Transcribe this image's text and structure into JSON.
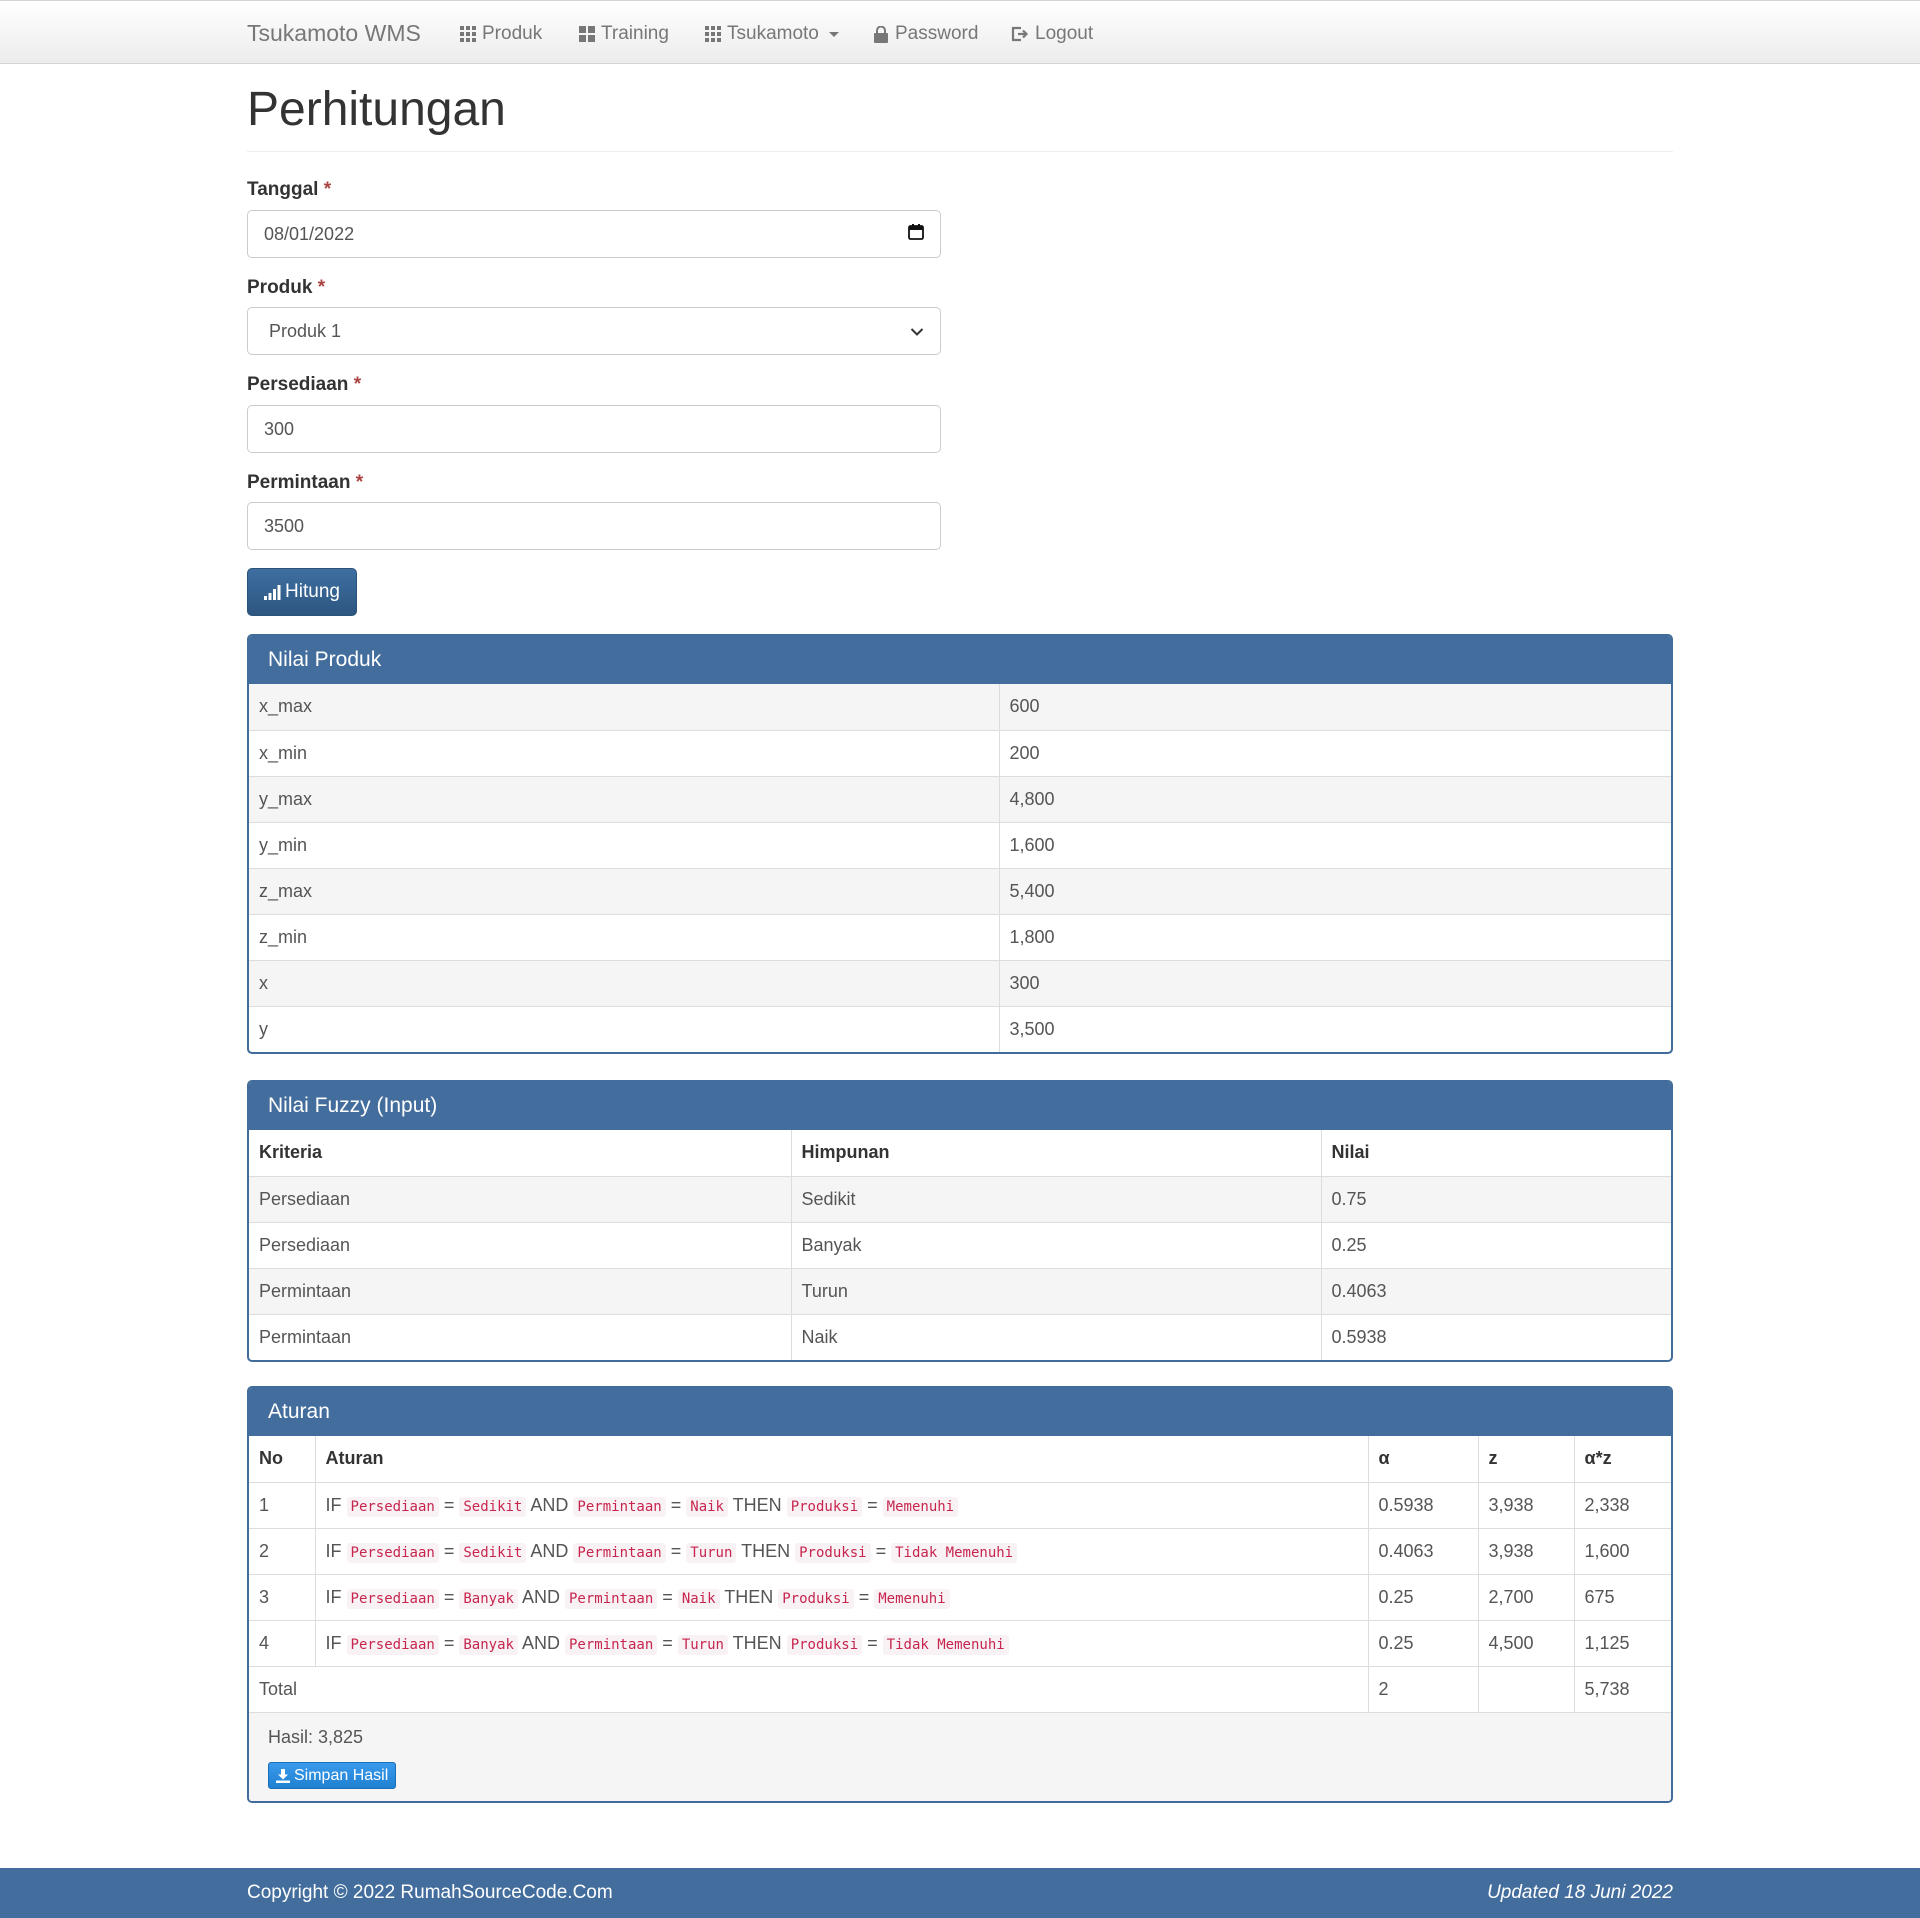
{
  "navbar": {
    "brand": "Tsukamoto WMS",
    "items": [
      {
        "label": "Produk",
        "icon": "grid-icon"
      },
      {
        "label": "Training",
        "icon": "th-large-icon"
      },
      {
        "label": "Tsukamoto",
        "icon": "grid-icon"
      },
      {
        "label": "Password",
        "icon": "lock-icon"
      },
      {
        "label": "Logout",
        "icon": "logout-icon"
      }
    ]
  },
  "page": {
    "title": "Perhitungan"
  },
  "form": {
    "required_mark": "*",
    "tanggal": {
      "label": "Tanggal",
      "value": "08/01/2022"
    },
    "produk": {
      "label": "Produk",
      "value": "Produk 1"
    },
    "persediaan": {
      "label": "Persediaan",
      "value": "300"
    },
    "permintaan": {
      "label": "Permintaan",
      "value": "3500"
    },
    "submit_label": "Hitung"
  },
  "nilai_produk": {
    "title": "Nilai Produk",
    "rows": [
      {
        "key": "x_max",
        "value": "600"
      },
      {
        "key": "x_min",
        "value": "200"
      },
      {
        "key": "y_max",
        "value": "4,800"
      },
      {
        "key": "y_min",
        "value": "1,600"
      },
      {
        "key": "z_max",
        "value": "5,400"
      },
      {
        "key": "z_min",
        "value": "1,800"
      },
      {
        "key": "x",
        "value": "300"
      },
      {
        "key": "y",
        "value": "3,500"
      }
    ]
  },
  "nilai_fuzzy": {
    "title": "Nilai Fuzzy (Input)",
    "headers": [
      "Kriteria",
      "Himpunan",
      "Nilai"
    ],
    "rows": [
      [
        "Persediaan",
        "Sedikit",
        "0.75"
      ],
      [
        "Persediaan",
        "Banyak",
        "0.25"
      ],
      [
        "Permintaan",
        "Turun",
        "0.4063"
      ],
      [
        "Permintaan",
        "Naik",
        "0.5938"
      ]
    ]
  },
  "aturan": {
    "title": "Aturan",
    "headers": [
      "No",
      "Aturan",
      "α",
      "z",
      "α*z"
    ],
    "kw": {
      "if": "IF",
      "and": "AND",
      "then": "THEN",
      "eq": "="
    },
    "rows": [
      {
        "no": "1",
        "v1": "Persediaan",
        "s1": "Sedikit",
        "v2": "Permintaan",
        "s2": "Naik",
        "v3": "Produksi",
        "s3": "Memenuhi",
        "alpha": "0.5938",
        "z": "3,938",
        "az": "2,338"
      },
      {
        "no": "2",
        "v1": "Persediaan",
        "s1": "Sedikit",
        "v2": "Permintaan",
        "s2": "Turun",
        "v3": "Produksi",
        "s3": "Tidak Memenuhi",
        "alpha": "0.4063",
        "z": "3,938",
        "az": "1,600"
      },
      {
        "no": "3",
        "v1": "Persediaan",
        "s1": "Banyak",
        "v2": "Permintaan",
        "s2": "Naik",
        "v3": "Produksi",
        "s3": "Memenuhi",
        "alpha": "0.25",
        "z": "2,700",
        "az": "675"
      },
      {
        "no": "4",
        "v1": "Persediaan",
        "s1": "Banyak",
        "v2": "Permintaan",
        "s2": "Turun",
        "v3": "Produksi",
        "s3": "Tidak Memenuhi",
        "alpha": "0.25",
        "z": "4,500",
        "az": "1,125"
      }
    ],
    "total": {
      "label": "Total",
      "alpha": "2",
      "z": "",
      "az": "5,738"
    },
    "hasil": "Hasil: 3,825",
    "save_label": "Simpan Hasil"
  },
  "footer": {
    "copyright": "Copyright © 2022 RumahSourceCode.Com",
    "updated": "Updated 18 Juni 2022"
  }
}
